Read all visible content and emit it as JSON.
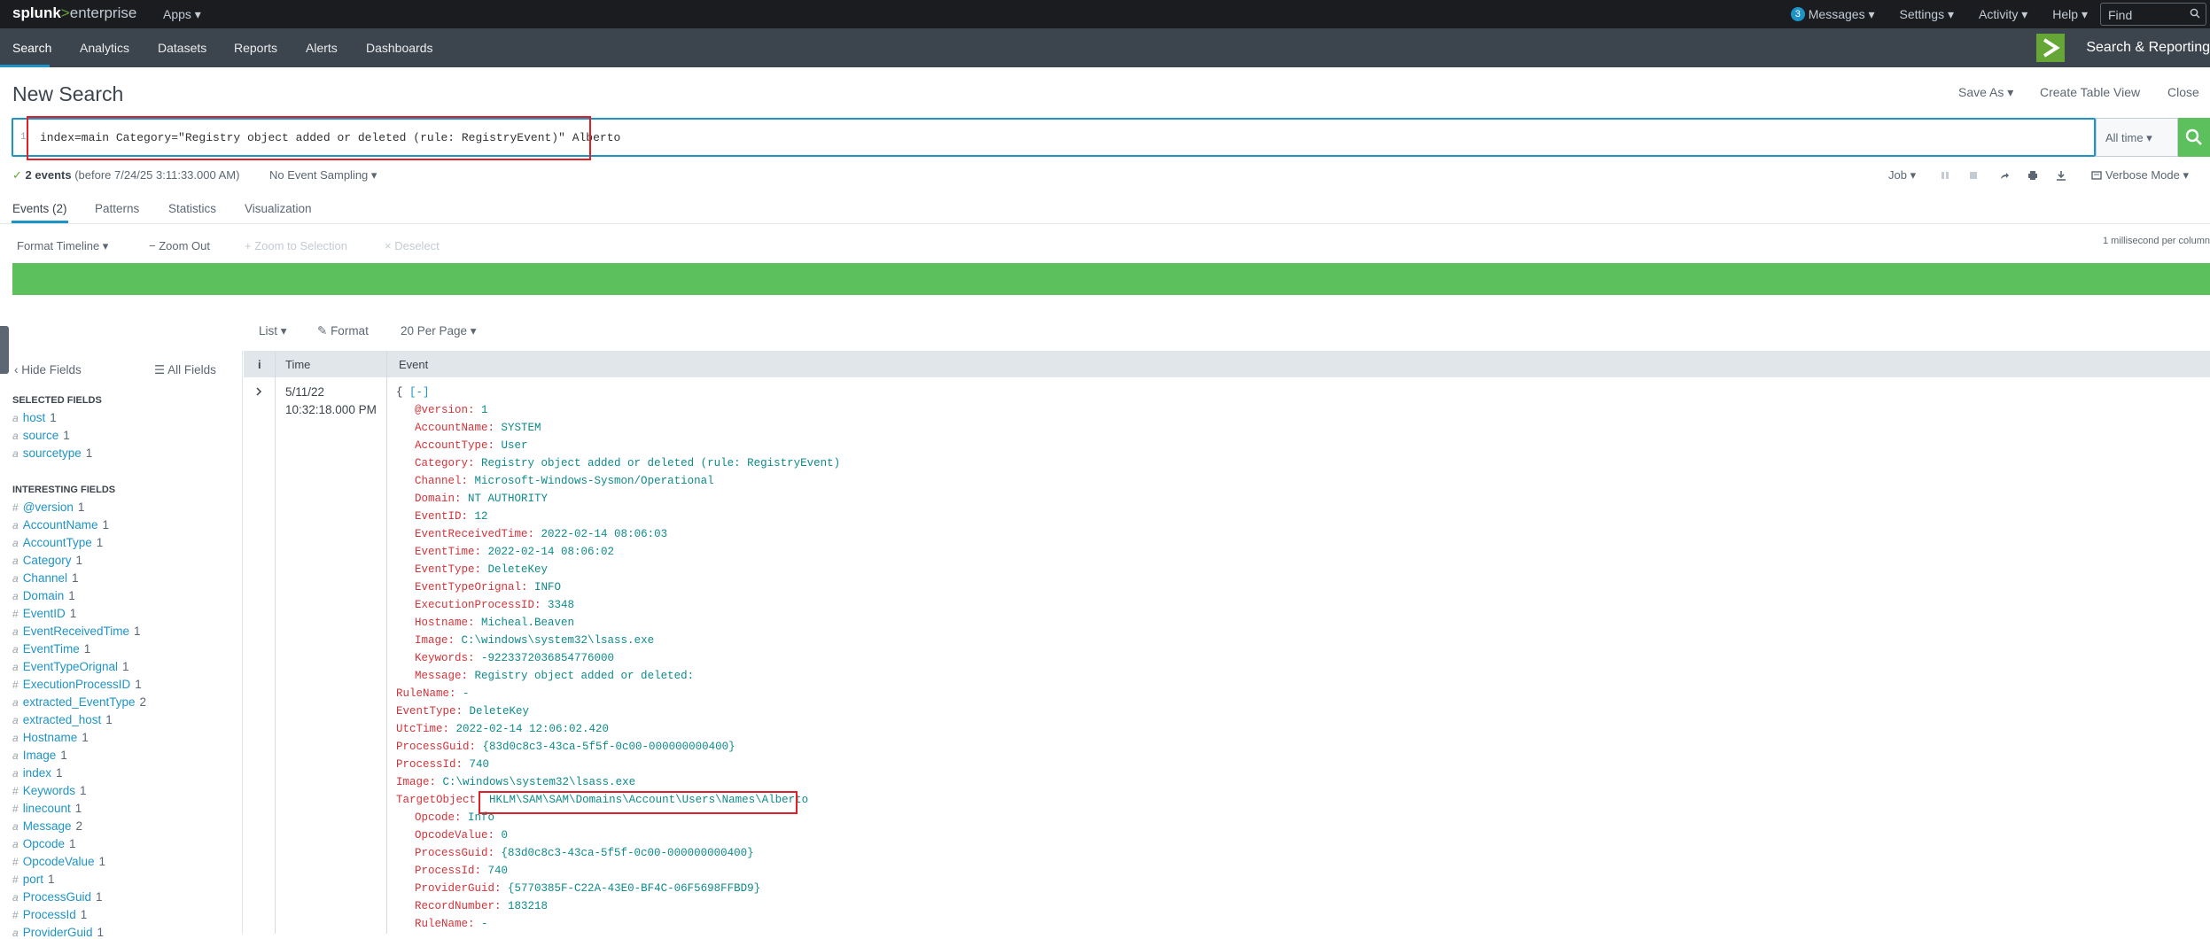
{
  "topbar": {
    "logo_splunk": "splunk",
    "logo_gt": ">",
    "logo_enterprise": "enterprise",
    "apps": "Apps ▾",
    "messages_count": "3",
    "messages": "Messages ▾",
    "settings": "Settings ▾",
    "activity": "Activity ▾",
    "help": "Help ▾",
    "find_placeholder": "Find"
  },
  "appbar": {
    "tabs": [
      "Search",
      "Analytics",
      "Datasets",
      "Reports",
      "Alerts",
      "Dashboards"
    ],
    "app_name": "Search & Reporting"
  },
  "header": {
    "title": "New Search",
    "save_as": "Save As ▾",
    "create_table_view": "Create Table View",
    "close": "Close"
  },
  "search": {
    "line_number": "1",
    "query": "index=main Category=\"Registry object added or deleted (rule: RegistryEvent)\" Alberto",
    "time_range": "All time ▾"
  },
  "status": {
    "check": "✓",
    "events": "2 events",
    "before": "(before 7/24/25 3:11:33.000 AM)",
    "sampling": "No Event Sampling ▾",
    "job": "Job ▾",
    "mode": "Verbose Mode ▾"
  },
  "tabs": [
    "Events (2)",
    "Patterns",
    "Statistics",
    "Visualization"
  ],
  "timeline": {
    "format": "Format Timeline ▾",
    "zoom_out": "− Zoom Out",
    "zoom_selection": "+ Zoom to Selection",
    "deselect": "× Deselect",
    "scale_note": "1 millisecond per column"
  },
  "results_controls": {
    "list": "List ▾",
    "format": "Format",
    "per_page": "20 Per Page ▾"
  },
  "sidebar": {
    "hide_fields": "‹ Hide Fields",
    "all_fields": "All Fields",
    "selected_heading": "SELECTED FIELDS",
    "selected": [
      {
        "type": "a",
        "name": "host",
        "count": "1"
      },
      {
        "type": "a",
        "name": "source",
        "count": "1"
      },
      {
        "type": "a",
        "name": "sourcetype",
        "count": "1"
      }
    ],
    "interesting_heading": "INTERESTING FIELDS",
    "interesting": [
      {
        "type": "#",
        "name": "@version",
        "count": "1"
      },
      {
        "type": "a",
        "name": "AccountName",
        "count": "1"
      },
      {
        "type": "a",
        "name": "AccountType",
        "count": "1"
      },
      {
        "type": "a",
        "name": "Category",
        "count": "1"
      },
      {
        "type": "a",
        "name": "Channel",
        "count": "1"
      },
      {
        "type": "a",
        "name": "Domain",
        "count": "1"
      },
      {
        "type": "#",
        "name": "EventID",
        "count": "1"
      },
      {
        "type": "a",
        "name": "EventReceivedTime",
        "count": "1"
      },
      {
        "type": "a",
        "name": "EventTime",
        "count": "1"
      },
      {
        "type": "a",
        "name": "EventTypeOrignal",
        "count": "1"
      },
      {
        "type": "#",
        "name": "ExecutionProcessID",
        "count": "1"
      },
      {
        "type": "a",
        "name": "extracted_EventType",
        "count": "2"
      },
      {
        "type": "a",
        "name": "extracted_host",
        "count": "1"
      },
      {
        "type": "a",
        "name": "Hostname",
        "count": "1"
      },
      {
        "type": "a",
        "name": "Image",
        "count": "1"
      },
      {
        "type": "a",
        "name": "index",
        "count": "1"
      },
      {
        "type": "#",
        "name": "Keywords",
        "count": "1"
      },
      {
        "type": "#",
        "name": "linecount",
        "count": "1"
      },
      {
        "type": "a",
        "name": "Message",
        "count": "2"
      },
      {
        "type": "a",
        "name": "Opcode",
        "count": "1"
      },
      {
        "type": "#",
        "name": "OpcodeValue",
        "count": "1"
      },
      {
        "type": "#",
        "name": "port",
        "count": "1"
      },
      {
        "type": "a",
        "name": "ProcessGuid",
        "count": "1"
      },
      {
        "type": "#",
        "name": "ProcessId",
        "count": "1"
      },
      {
        "type": "a",
        "name": "ProviderGuid",
        "count": "1"
      }
    ]
  },
  "table": {
    "col_i": "i",
    "col_time": "Time",
    "col_event": "Event",
    "row_date": "5/11/22",
    "row_time": "10:32:18.000 PM",
    "open_brace": "{",
    "collapse": "[-]",
    "lines": [
      {
        "k": "@version:",
        "v": "1",
        "indent": true
      },
      {
        "k": "AccountName:",
        "v": "SYSTEM",
        "indent": true
      },
      {
        "k": "AccountType:",
        "v": "User",
        "indent": true
      },
      {
        "k": "Category:",
        "v": "Registry object added or deleted (rule: RegistryEvent)",
        "indent": true
      },
      {
        "k": "Channel:",
        "v": "Microsoft-Windows-Sysmon/Operational",
        "indent": true
      },
      {
        "k": "Domain:",
        "v": "NT AUTHORITY",
        "indent": true
      },
      {
        "k": "EventID:",
        "v": "12",
        "indent": true
      },
      {
        "k": "EventReceivedTime:",
        "v": "2022-02-14 08:06:03",
        "indent": true
      },
      {
        "k": "EventTime:",
        "v": "2022-02-14 08:06:02",
        "indent": true
      },
      {
        "k": "EventType:",
        "v": "DeleteKey",
        "indent": true
      },
      {
        "k": "EventTypeOrignal:",
        "v": "INFO",
        "indent": true
      },
      {
        "k": "ExecutionProcessID:",
        "v": "3348",
        "indent": true
      },
      {
        "k": "Hostname:",
        "v": "Micheal.Beaven",
        "indent": true
      },
      {
        "k": "Image:",
        "v": "C:\\windows\\system32\\lsass.exe",
        "indent": true
      },
      {
        "k": "Keywords:",
        "v": "-9223372036854776000",
        "indent": true
      },
      {
        "k": "Message:",
        "v": "Registry object added or deleted:",
        "indent": true
      },
      {
        "k": "RuleName:",
        "v": "-",
        "indent": false
      },
      {
        "k": "EventType:",
        "v": "DeleteKey",
        "indent": false
      },
      {
        "k": "UtcTime:",
        "v": "2022-02-14 12:06:02.420",
        "indent": false
      },
      {
        "k": "ProcessGuid:",
        "v": "{83d0c8c3-43ca-5f5f-0c00-000000000400}",
        "indent": false
      },
      {
        "k": "ProcessId:",
        "v": "740",
        "indent": false
      },
      {
        "k": "Image:",
        "v": "C:\\windows\\system32\\lsass.exe",
        "indent": false
      },
      {
        "k": "TargetObject:",
        "v": "HKLM\\SAM\\SAM\\Domains\\Account\\Users\\Names\\Alberto",
        "indent": false
      },
      {
        "k": "Opcode:",
        "v": "Info",
        "indent": true
      },
      {
        "k": "OpcodeValue:",
        "v": "0",
        "indent": true
      },
      {
        "k": "ProcessGuid:",
        "v": "{83d0c8c3-43ca-5f5f-0c00-000000000400}",
        "indent": true
      },
      {
        "k": "ProcessId:",
        "v": "740",
        "indent": true
      },
      {
        "k": "ProviderGuid:",
        "v": "{5770385F-C22A-43E0-BF4C-06F5698FFBD9}",
        "indent": true
      },
      {
        "k": "RecordNumber:",
        "v": "183218",
        "indent": true
      },
      {
        "k": "RuleName:",
        "v": "-",
        "indent": true
      }
    ]
  },
  "colors": {
    "accent": "#1e93c6",
    "green": "#5cc05c",
    "highlight_box": "#e01f27"
  }
}
